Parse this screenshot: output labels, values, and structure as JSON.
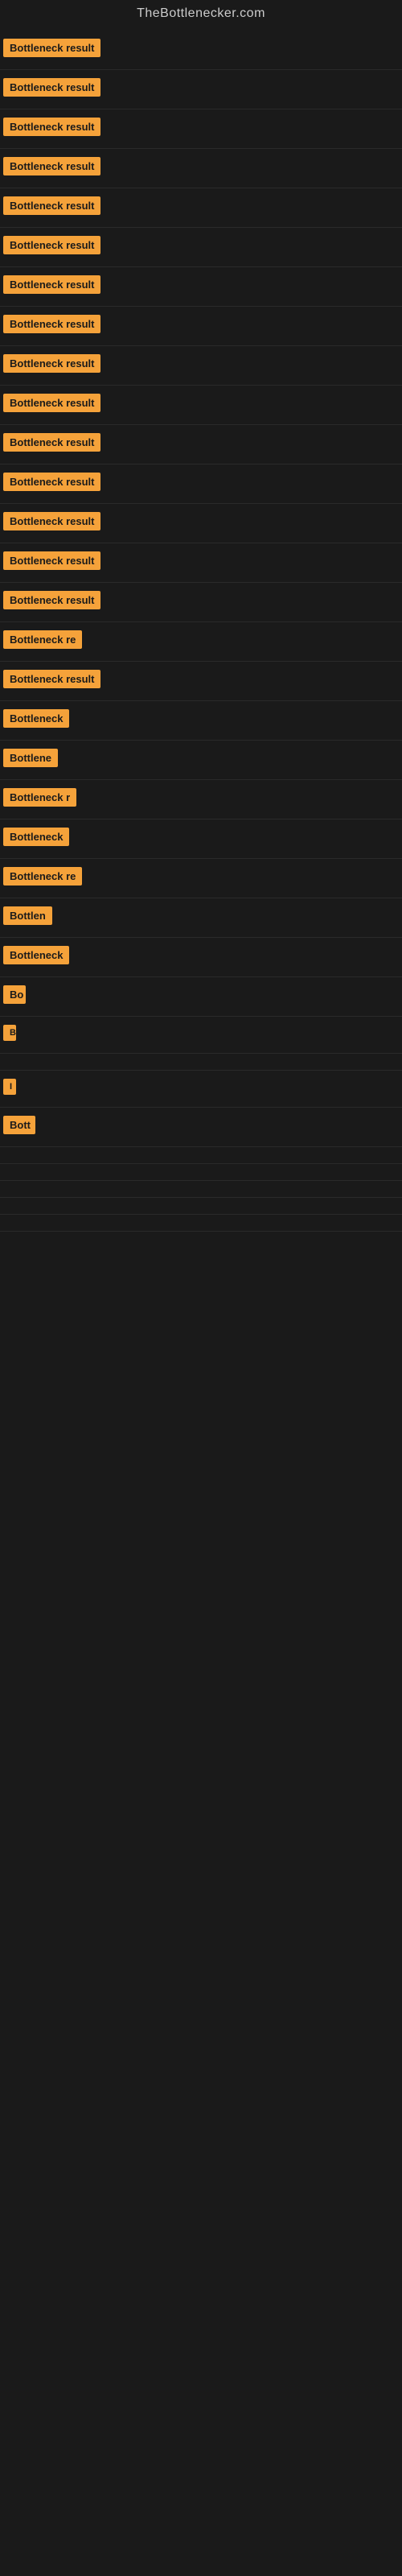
{
  "site": {
    "title": "TheBottlenecker.com"
  },
  "items": [
    {
      "label": "Bottleneck result",
      "width": 140
    },
    {
      "label": "Bottleneck result",
      "width": 140
    },
    {
      "label": "Bottleneck result",
      "width": 140
    },
    {
      "label": "Bottleneck result",
      "width": 140
    },
    {
      "label": "Bottleneck result",
      "width": 140
    },
    {
      "label": "Bottleneck result",
      "width": 140
    },
    {
      "label": "Bottleneck result",
      "width": 140
    },
    {
      "label": "Bottleneck result",
      "width": 140
    },
    {
      "label": "Bottleneck result",
      "width": 140
    },
    {
      "label": "Bottleneck result",
      "width": 140
    },
    {
      "label": "Bottleneck result",
      "width": 140
    },
    {
      "label": "Bottleneck result",
      "width": 140
    },
    {
      "label": "Bottleneck result",
      "width": 140
    },
    {
      "label": "Bottleneck result",
      "width": 140
    },
    {
      "label": "Bottleneck result",
      "width": 140
    },
    {
      "label": "Bottleneck re",
      "width": 110
    },
    {
      "label": "Bottleneck result",
      "width": 130
    },
    {
      "label": "Bottleneck",
      "width": 90
    },
    {
      "label": "Bottlene",
      "width": 75
    },
    {
      "label": "Bottleneck r",
      "width": 100
    },
    {
      "label": "Bottleneck",
      "width": 88
    },
    {
      "label": "Bottleneck re",
      "width": 108
    },
    {
      "label": "Bottlen",
      "width": 68
    },
    {
      "label": "Bottleneck",
      "width": 85
    },
    {
      "label": "Bo",
      "width": 28
    },
    {
      "label": "B",
      "width": 14
    },
    {
      "label": "",
      "width": 0
    },
    {
      "label": "I",
      "width": 8
    },
    {
      "label": "Bott",
      "width": 40
    },
    {
      "label": "",
      "width": 0
    },
    {
      "label": "",
      "width": 0
    },
    {
      "label": "",
      "width": 0
    },
    {
      "label": "",
      "width": 0
    },
    {
      "label": "",
      "width": 0
    }
  ],
  "colors": {
    "label_bg": "#f5a23a",
    "label_text": "#1a1a1a",
    "bg": "#1a1a1a",
    "title": "#cccccc"
  }
}
